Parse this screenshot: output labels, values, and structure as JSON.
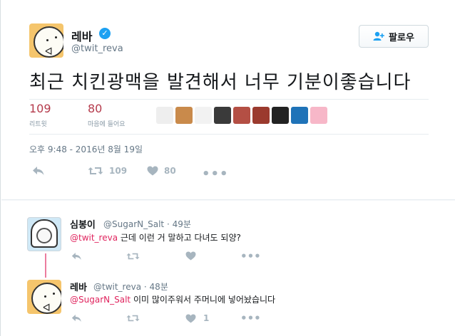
{
  "tweet": {
    "author_name": "레바",
    "author_handle": "@twit_reva",
    "follow_label": "팔로우",
    "text": "최근 치킨광맥을 발견해서 너무 기분이좋습니다",
    "retweets": {
      "count": "109",
      "label": "리트윗"
    },
    "likes": {
      "count": "80",
      "label": "마음에 들어요"
    },
    "timestamp": "오후 9:48 - 2016년 8월 19일",
    "actions": {
      "retweet_count": "109",
      "like_count": "80"
    },
    "liker_colors": [
      "#eeeeee",
      "#c98a4b",
      "#f2f2f2",
      "#3a3a3a",
      "#b44f44",
      "#9b3a2e",
      "#222222",
      "#1f73b8",
      "#f7b7c8"
    ]
  },
  "replies": [
    {
      "name": "심봉이",
      "handle": "@SugarN_Salt",
      "time": "49분",
      "mention": "@twit_reva",
      "text": " 근데 이런 거 말하고 다녀도 되양?",
      "like_count": ""
    },
    {
      "name": "레바",
      "handle": "@twit_reva",
      "time": "48분",
      "mention": "@SugarN_Salt",
      "text": " 이미 많이주워서 주머니에 넣어놨습니다",
      "like_count": "1"
    }
  ],
  "colors": {
    "accent": "#1da1f2",
    "stat": "#b53b4c",
    "mention": "#e0245e",
    "icon": "#a7b5bf"
  }
}
